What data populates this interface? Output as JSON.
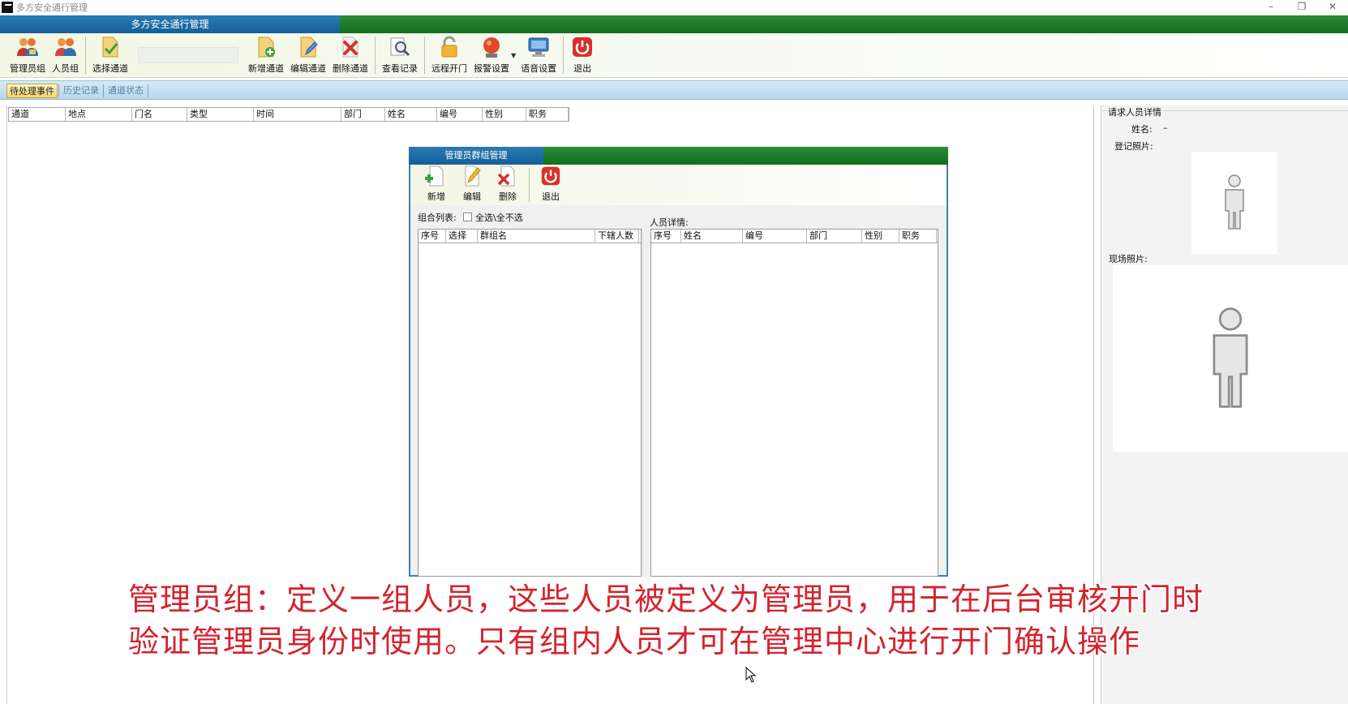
{
  "window": {
    "title": "多方安全通行管理",
    "controls": [
      "–",
      "❐",
      "✕"
    ]
  },
  "header": {
    "tab": "多方安全通行管理"
  },
  "toolbar": {
    "buttons": [
      {
        "label": "管理员组",
        "icon": "admin-group-icon"
      },
      {
        "label": "人员组",
        "icon": "people-group-icon"
      },
      {
        "label": "选择通道",
        "icon": "select-channel-icon"
      },
      {
        "label": "新增通道",
        "icon": "add-channel-icon"
      },
      {
        "label": "编辑通道",
        "icon": "edit-channel-icon"
      },
      {
        "label": "删除通道",
        "icon": "delete-channel-icon"
      },
      {
        "label": "查看记录",
        "icon": "view-records-icon"
      },
      {
        "label": "远程开门",
        "icon": "remote-unlock-icon"
      },
      {
        "label": "报警设置",
        "icon": "alarm-settings-icon"
      },
      {
        "label": "语音设置",
        "icon": "voice-settings-icon"
      },
      {
        "label": "退出",
        "icon": "power-icon"
      }
    ],
    "channel_input_value": ""
  },
  "tabs": [
    {
      "label": "待处理事件",
      "active": true
    },
    {
      "label": "历史记录",
      "active": false
    },
    {
      "label": "通道状态",
      "active": false
    }
  ],
  "event_table": {
    "columns": [
      "通道",
      "地点",
      "门名",
      "类型",
      "时间",
      "部门",
      "姓名",
      "编号",
      "性别",
      "职务"
    ]
  },
  "right_panel": {
    "title": "请求人员详情",
    "name_label": "姓名:",
    "name_value": "–",
    "registered_photo_label": "登记照片:",
    "live_photo_label": "现场照片:"
  },
  "modal": {
    "title": "管理员群组管理",
    "toolbar": [
      {
        "label": "新增",
        "icon": "add-icon"
      },
      {
        "label": "编辑",
        "icon": "edit-icon"
      },
      {
        "label": "删除",
        "icon": "delete-icon"
      },
      {
        "label": "退出",
        "icon": "power-icon"
      }
    ],
    "group_list_label": "组合列表:",
    "select_all_label": "全选\\全不选",
    "select_all_checked": false,
    "group_columns": [
      "序号",
      "选择",
      "群组名",
      "下辖人数"
    ],
    "person_detail_label": "人员详情:",
    "person_columns": [
      "序号",
      "姓名",
      "编号",
      "部门",
      "性别",
      "职务"
    ]
  },
  "caption": {
    "line1": "管理员组：定义一组人员，这些人员被定义为管理员，用于在后台审核开门时",
    "line2": "验证管理员身份时使用。只有组内人员才可在管理中心进行开门确认操作"
  },
  "colors": {
    "accent_green": "#106e1e",
    "accent_blue": "#135f99",
    "caption_red": "#d3242f",
    "active_tab": "#f7d36a"
  }
}
